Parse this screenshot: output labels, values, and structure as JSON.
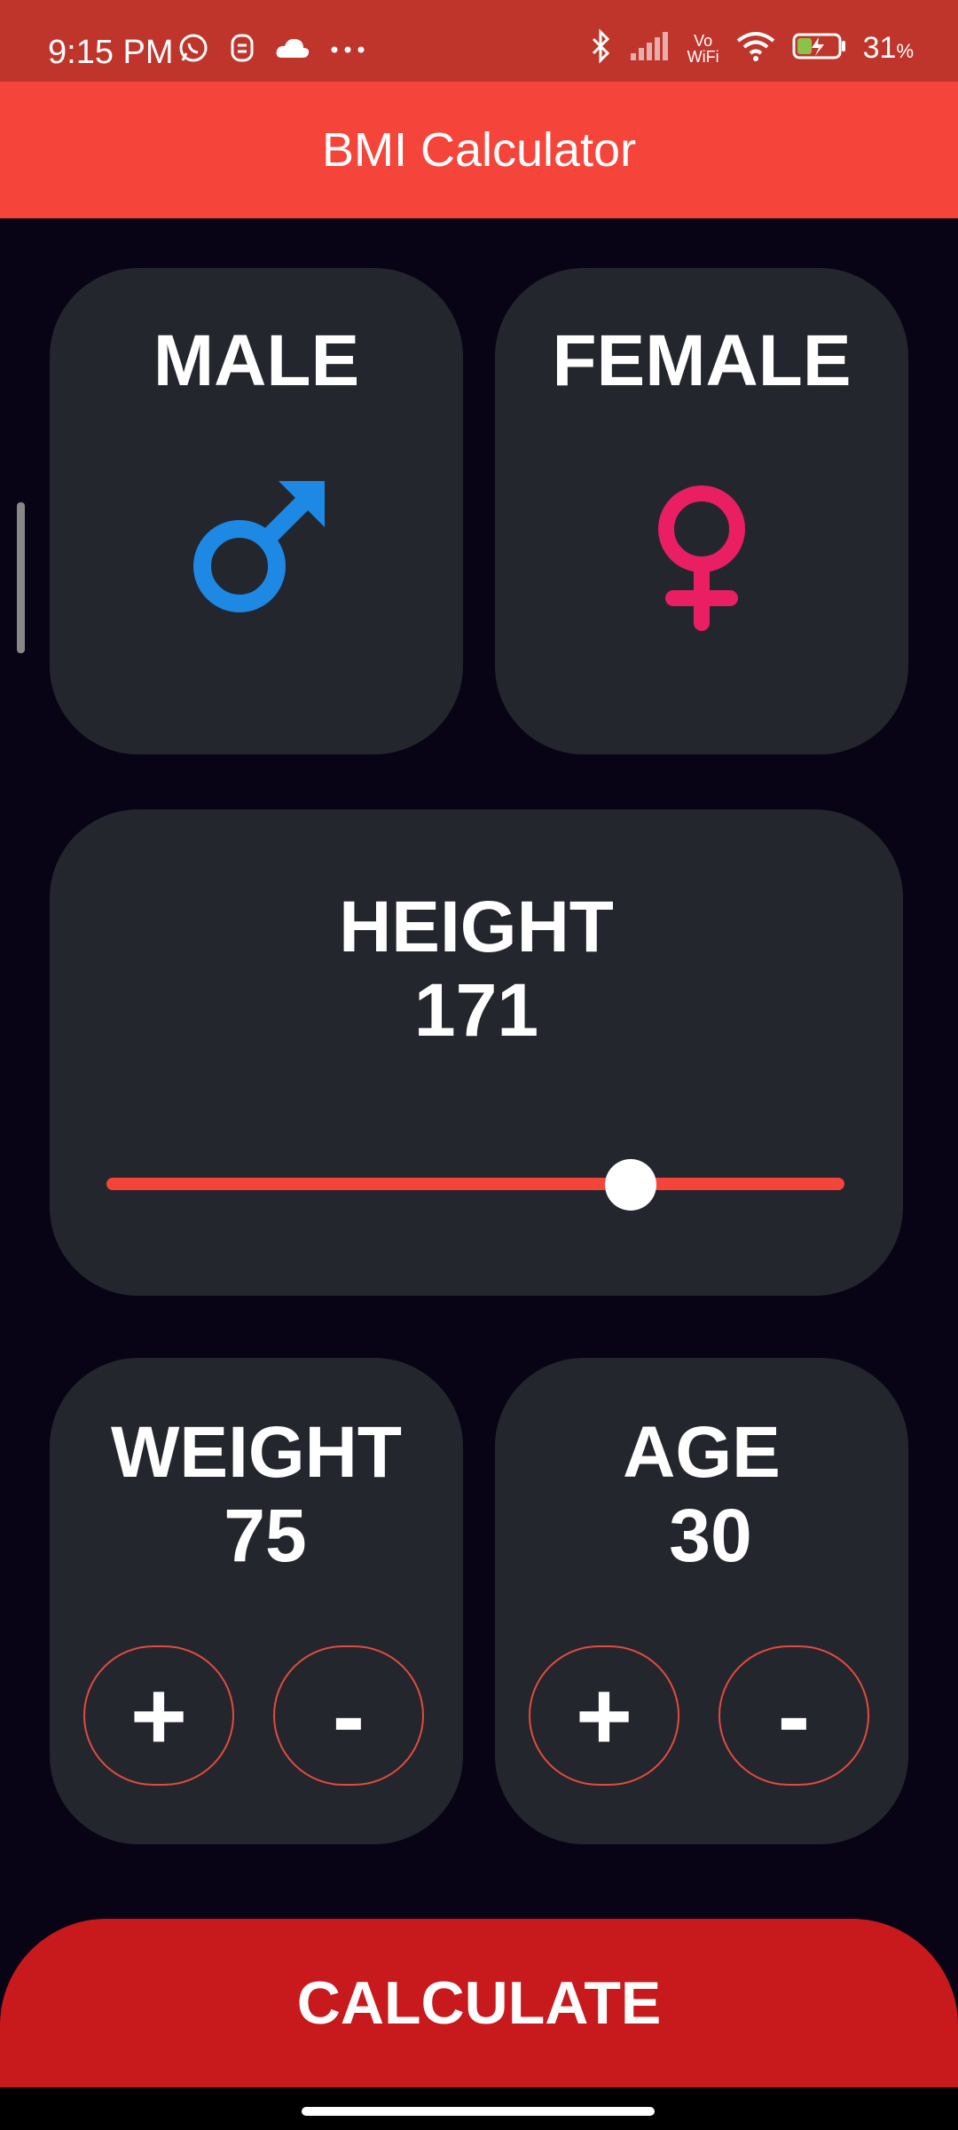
{
  "status_bar": {
    "time": "9:15 PM",
    "battery": "31",
    "battery_unit": "%",
    "icons": [
      "whatsapp-icon",
      "notification-icon",
      "cloud-icon",
      "more-icon",
      "bluetooth-icon",
      "signal-icon",
      "vowifi-icon",
      "wifi-icon",
      "battery-icon"
    ],
    "vowifi_top": "Vo",
    "vowifi_bottom": "WiFi"
  },
  "app_bar": {
    "title": "BMI Calculator"
  },
  "gender": {
    "male_label": "MALE",
    "female_label": "FEMALE",
    "male_color": "#1e88e5",
    "female_color": "#e91e63"
  },
  "height": {
    "label": "HEIGHT",
    "value": "171",
    "slider_fraction": 0.71,
    "accent_color": "#f5443a"
  },
  "weight": {
    "label": "WEIGHT",
    "value": "75",
    "plus_label": "+",
    "minus_label": "-"
  },
  "age": {
    "label": "AGE",
    "value": "30",
    "plus_label": "+",
    "minus_label": "-"
  },
  "calculate": {
    "label": "CALCULATE",
    "color": "#c8191d"
  }
}
